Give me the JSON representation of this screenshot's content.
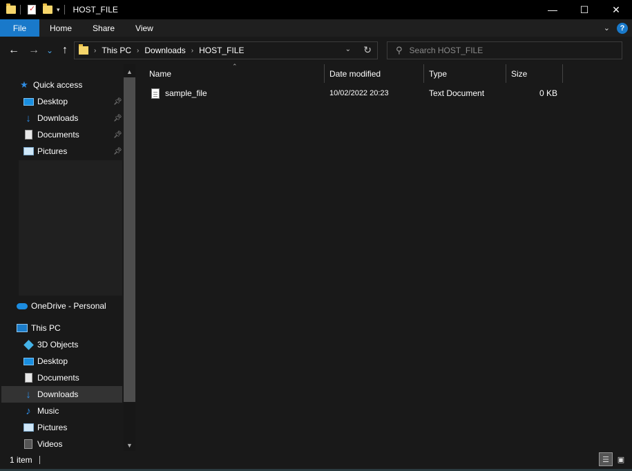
{
  "window": {
    "title": "HOST_FILE",
    "controls": {
      "minimize": "—",
      "maximize": "☐",
      "close": "✕"
    }
  },
  "ribbon": {
    "tabs": [
      "File",
      "Home",
      "Share",
      "View"
    ],
    "help": "?",
    "accent": "#1979ca"
  },
  "nav": {
    "back": "←",
    "forward": "→",
    "recent": "⌄",
    "up": "↑"
  },
  "address": {
    "crumbs": [
      "This PC",
      "Downloads",
      "HOST_FILE"
    ]
  },
  "search": {
    "placeholder": "Search HOST_FILE"
  },
  "sidebar": {
    "quick_access": {
      "label": "Quick access",
      "items": [
        {
          "label": "Desktop",
          "icon": "desktop-icon",
          "pinned": true
        },
        {
          "label": "Downloads",
          "icon": "downloads-icon",
          "pinned": true
        },
        {
          "label": "Documents",
          "icon": "documents-icon",
          "pinned": true
        },
        {
          "label": "Pictures",
          "icon": "pictures-icon",
          "pinned": true
        }
      ]
    },
    "onedrive": {
      "label": "OneDrive - Personal"
    },
    "this_pc": {
      "label": "This PC",
      "items": [
        {
          "label": "3D Objects",
          "icon": "3d-objects-icon"
        },
        {
          "label": "Desktop",
          "icon": "desktop-icon"
        },
        {
          "label": "Documents",
          "icon": "documents-icon"
        },
        {
          "label": "Downloads",
          "icon": "downloads-icon",
          "selected": true
        },
        {
          "label": "Music",
          "icon": "music-icon"
        },
        {
          "label": "Pictures",
          "icon": "pictures-icon"
        },
        {
          "label": "Videos",
          "icon": "videos-icon"
        }
      ]
    }
  },
  "columns": [
    "Name",
    "Date modified",
    "Type",
    "Size"
  ],
  "files": [
    {
      "name": "sample_file",
      "date": "10/02/2022 20:23",
      "type": "Text Document",
      "size": "0 KB"
    }
  ],
  "status": {
    "count": "1 item"
  }
}
